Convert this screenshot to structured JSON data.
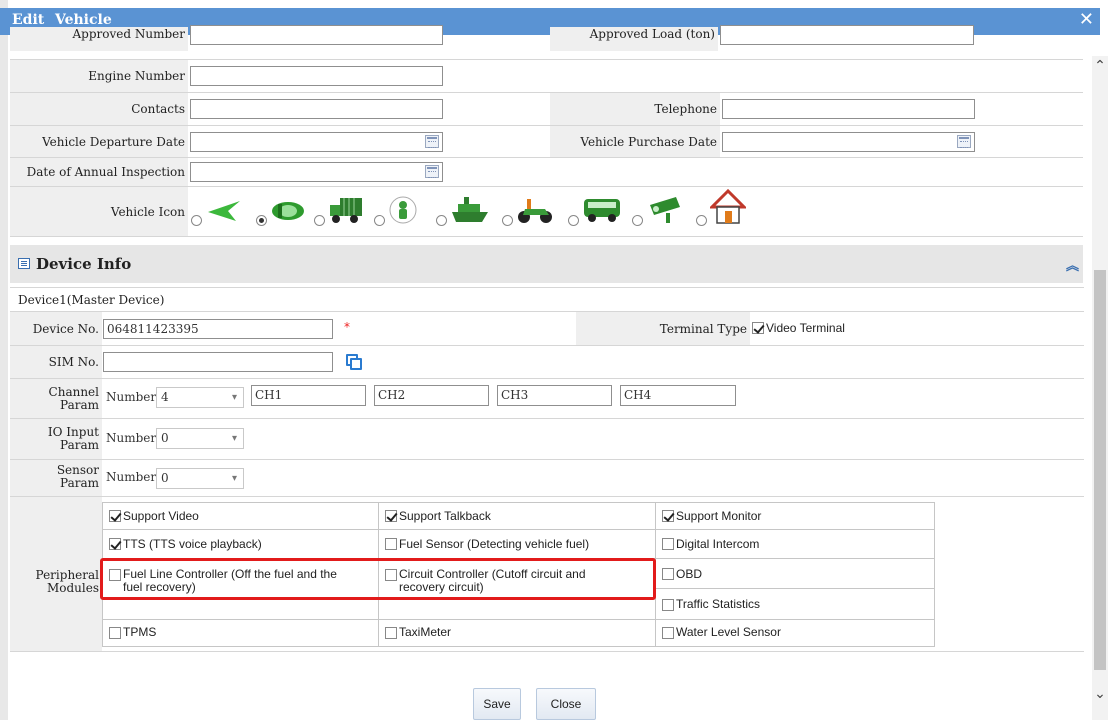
{
  "dialog": {
    "title_edit": "Edit",
    "title_vehicle": "Vehicle",
    "close_glyph": "✕"
  },
  "vehicle": {
    "approved_number_label": "Approved Number",
    "approved_load_label": "Approved Load (ton)",
    "engine_number_label": "Engine Number",
    "engine_number_value": "",
    "contacts_label": "Contacts",
    "contacts_value": "",
    "telephone_label": "Telephone",
    "telephone_value": "",
    "departure_date_label": "Vehicle Departure Date",
    "purchase_date_label": "Vehicle Purchase Date",
    "annual_inspection_label": "Date of Annual Inspection",
    "vehicle_icon_label": "Vehicle Icon",
    "vehicle_icons": [
      "arrow-icon",
      "car-icon",
      "truck-icon",
      "person-icon",
      "ship-icon",
      "motorcycle-icon",
      "bus-icon",
      "camera-icon",
      "house-icon"
    ],
    "selected_icon_index": 1
  },
  "device_info": {
    "section_title": "Device Info",
    "device_title": "Device1(Master Device)",
    "device_no_label": "Device No.",
    "device_no_value": "064811423395",
    "required_mark": "*",
    "terminal_type_label": "Terminal Type",
    "terminal_type_option": "Video Terminal",
    "terminal_type_checked": true,
    "sim_no_label": "SIM No.",
    "sim_no_value": "",
    "channel_param_label_1": "Channel",
    "channel_param_label_2": "Param",
    "number_label": "Number",
    "channel_number": "4",
    "channels": [
      "CH1",
      "CH2",
      "CH3",
      "CH4"
    ],
    "io_label_1": "IO Input",
    "io_label_2": "Param",
    "io_number": "0",
    "sensor_label_1": "Sensor",
    "sensor_label_2": "Param",
    "sensor_number": "0",
    "peripheral_label_1": "Peripheral",
    "peripheral_label_2": "Modules"
  },
  "peripherals": [
    {
      "label": "Support Video",
      "checked": true
    },
    {
      "label": "Support Talkback",
      "checked": true
    },
    {
      "label": "Support Monitor",
      "checked": true
    },
    {
      "label": "TTS (TTS voice playback)",
      "checked": true
    },
    {
      "label": "Fuel Sensor (Detecting vehicle fuel)",
      "checked": false
    },
    {
      "label": "Digital Intercom",
      "checked": false
    },
    {
      "label": "Fuel Line Controller (Off the fuel and the",
      "label2": "fuel recovery)",
      "checked": false
    },
    {
      "label": "Circuit Controller (Cutoff circuit and",
      "label2": "recovery circuit)",
      "checked": false
    },
    {
      "label": "OBD",
      "checked": false
    },
    {
      "label": "Traffic Statistics",
      "checked": false
    },
    {
      "label": "TPMS",
      "checked": false
    },
    {
      "label": "TaxiMeter",
      "checked": false
    },
    {
      "label": "Water Level Sensor",
      "checked": false
    }
  ],
  "buttons": {
    "save": "Save",
    "close": "Close"
  },
  "colors": {
    "titlebar": "#5a93d3",
    "highlight_box": "#e21b1b",
    "required": "#e22222"
  }
}
